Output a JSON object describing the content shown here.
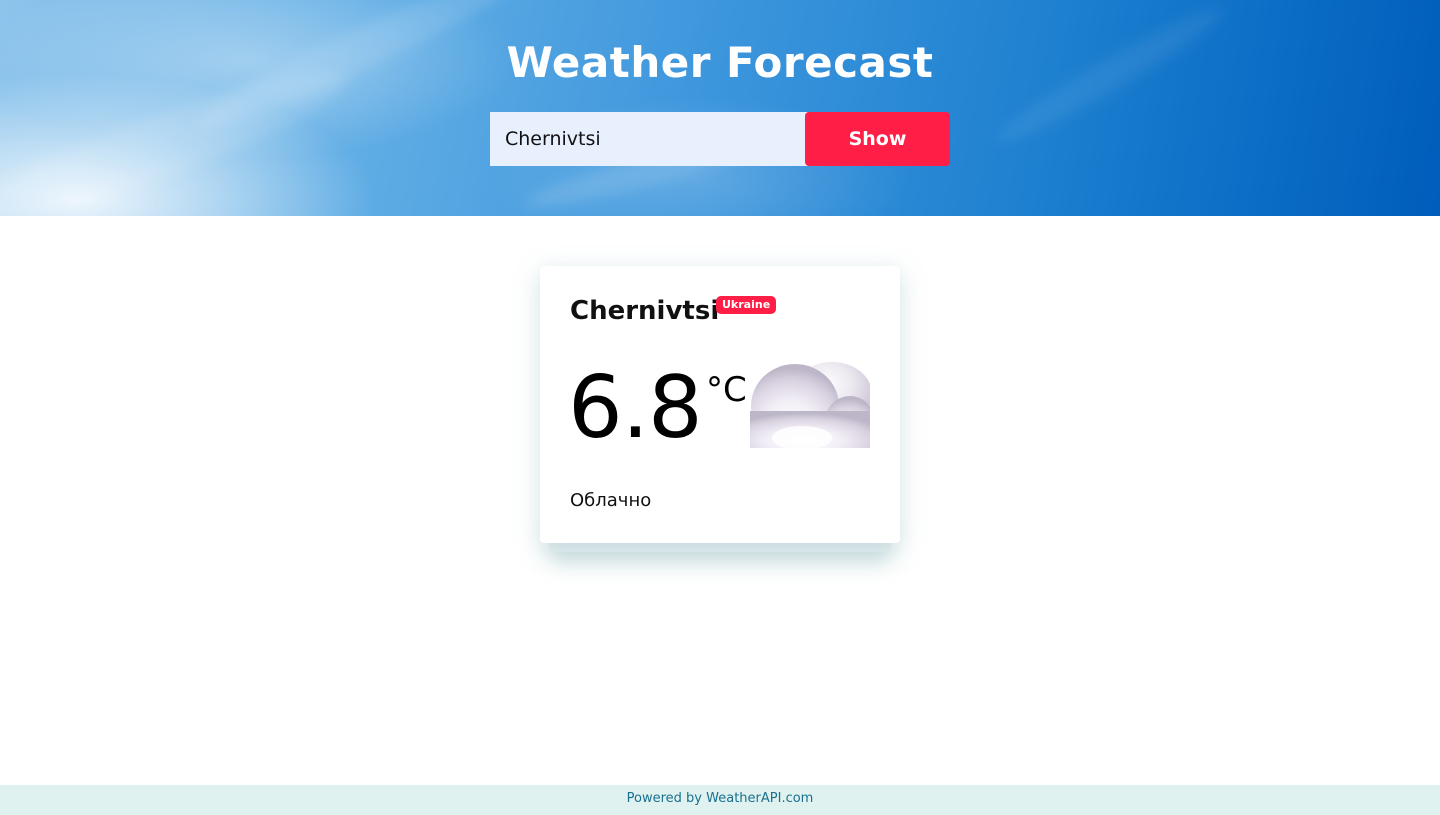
{
  "header": {
    "title": "Weather Forecast"
  },
  "search": {
    "value": "Chernivtsi",
    "button_label": "Show"
  },
  "weather": {
    "city": "Chernivtsi",
    "country": "Ukraine",
    "temperature": "6.8",
    "unit": "°C",
    "condition": "Облачно",
    "icon": "cloud-icon"
  },
  "footer": {
    "text": "Powered by WeatherAPI.com"
  },
  "colors": {
    "accent": "#ff1e45",
    "input_bg": "#e8f0fe",
    "footer_bg": "#e0f2ef",
    "footer_text": "#1a6f90"
  }
}
